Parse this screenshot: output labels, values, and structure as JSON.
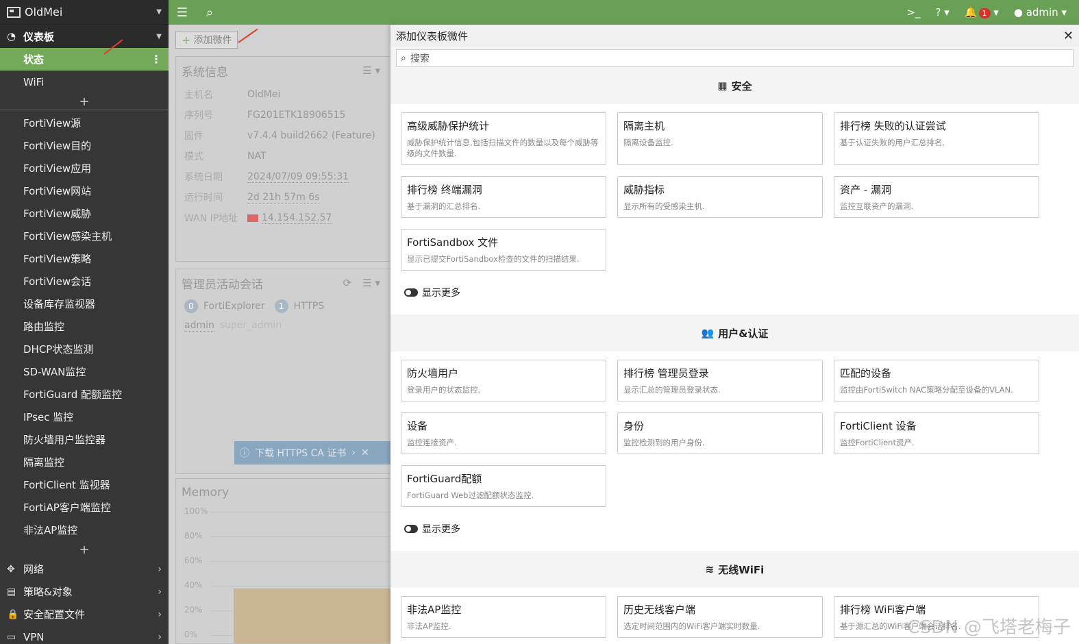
{
  "sidebar": {
    "brand": "OldMei",
    "section_title": "仪表板",
    "dashboard_items": [
      {
        "label": "状态",
        "active": true
      },
      {
        "label": "WiFi",
        "active": false
      }
    ],
    "monitor_items": [
      "FortiView源",
      "FortiView目的",
      "FortiView应用",
      "FortiView网站",
      "FortiView威胁",
      "FortiView感染主机",
      "FortiView策略",
      "FortiView会话",
      "设备库存监视器",
      "路由监控",
      "DHCP状态监测",
      "SD-WAN监控",
      "FortiGuard 配额监控",
      "IPsec 监控",
      "防火墙用户监控器",
      "隔离监控",
      "FortiClient 监视器",
      "FortiAP客户端监控",
      "非法AP监控"
    ],
    "groups": [
      {
        "label": "网络",
        "icon": "move-icon"
      },
      {
        "label": "策略&对象",
        "icon": "policy-icon"
      },
      {
        "label": "安全配置文件",
        "icon": "lock-icon"
      },
      {
        "label": "VPN",
        "icon": "laptop-icon"
      }
    ]
  },
  "topbar": {
    "user": "admin",
    "alert_count": "1"
  },
  "dashboard": {
    "add_widget": "添加微件",
    "system_info": {
      "title": "系统信息",
      "rows": [
        {
          "k": "主机名",
          "v": "OldMei",
          "u": false
        },
        {
          "k": "序列号",
          "v": "FG201ETK18906515",
          "u": false
        },
        {
          "k": "固件",
          "v": "v7.4.4 build2662 (Feature)",
          "u": false
        },
        {
          "k": "模式",
          "v": "NAT",
          "u": false
        },
        {
          "k": "系统日期",
          "v": "2024/07/09 09:55:31",
          "u": true
        },
        {
          "k": "运行时间",
          "v": "2d 21h 57m 6s",
          "u": true
        },
        {
          "k": "WAN IP地址",
          "v": "14.154.152.57",
          "u": true
        }
      ]
    },
    "admin_sessions": {
      "title": "管理员活动会话",
      "counts": [
        {
          "n": "0",
          "label": "FortiExplorer"
        },
        {
          "n": "1",
          "label": "HTTPS"
        }
      ],
      "user": "admin",
      "role": "super_admin"
    },
    "https_bar": "下载 HTTPS CA 证书",
    "memory": {
      "title": "Memory",
      "ticks": [
        "100%",
        "80%",
        "60%",
        "40%",
        "20%",
        "0%"
      ]
    }
  },
  "panel": {
    "title": "添加仪表板微件",
    "search_placeholder": "搜索",
    "show_more": "显示更多",
    "categories": [
      {
        "title": "安全",
        "icon": "security-icon",
        "cards": [
          {
            "t": "高级威胁保护统计",
            "d": "威胁保护统计信息,包括扫描文件的数量以及每个威胁等级的文件数量."
          },
          {
            "t": "隔离主机",
            "d": "隔离设备监控."
          },
          {
            "t": "排行榜 失败的认证尝试",
            "d": "基于认证失败的用户汇总排名."
          },
          {
            "t": "排行榜 终端漏洞",
            "d": "基于漏洞的汇总排名."
          },
          {
            "t": "威胁指标",
            "d": "显示所有的受感染主机."
          },
          {
            "t": "资产 - 漏洞",
            "d": "监控互联资产的漏洞."
          },
          {
            "t": "FortiSandbox 文件",
            "d": "显示已提交FortiSandbox检查的文件的扫描结果."
          }
        ]
      },
      {
        "title": "用户&认证",
        "icon": "users-icon",
        "cards": [
          {
            "t": "防火墙用户",
            "d": "登录用户的状态监控."
          },
          {
            "t": "排行榜 管理员登录",
            "d": "显示汇总的管理员登录状态."
          },
          {
            "t": "匹配的设备",
            "d": "监控由FortiSwitch NAC策略分配至设备的VLAN."
          },
          {
            "t": "设备",
            "d": "监控连接资产."
          },
          {
            "t": "身份",
            "d": "监控检测到的用户身份."
          },
          {
            "t": "FortiClient 设备",
            "d": "监控FortiClient资产."
          },
          {
            "t": "FortiGuard配额",
            "d": "FortiGuard Web过滤配额状态监控."
          }
        ]
      },
      {
        "title": "无线WiFi",
        "icon": "wifi-icon",
        "cards": [
          {
            "t": "非法AP监控",
            "d": "非法AP监控."
          },
          {
            "t": "历史无线客户端",
            "d": "选定时间范围内的WiFi客户端实时数量."
          },
          {
            "t": "排行榜 WiFi客户端",
            "d": "基于源汇总的WiFi客户端会话排名."
          }
        ]
      }
    ]
  },
  "watermark": "CSDN @飞塔老梅子"
}
